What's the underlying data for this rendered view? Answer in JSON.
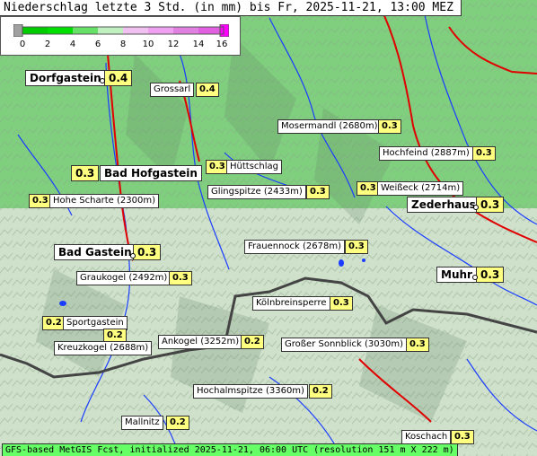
{
  "title": "Niederschlag letzte 3 Std. (in mm) bis Fr, 2025-11-21, 13:00 MEZ",
  "legend": {
    "ticks": [
      "0",
      "2",
      "4",
      "6",
      "8",
      "10",
      "12",
      "14",
      "16"
    ],
    "colors": [
      "#a0a0a0",
      "#00cc00",
      "#00e000",
      "#c0f0c0",
      "#f0c0f0",
      "#e080e0",
      "#ff00ff"
    ]
  },
  "places": [
    {
      "name": "Dorfgastein",
      "value": "0.4"
    },
    {
      "name": "Grossarl",
      "value": "0.4"
    },
    {
      "name": "Mosermandl (2680m)",
      "value": "0.3"
    },
    {
      "name": "Hochfeind (2887m)",
      "value": "0.3"
    },
    {
      "name": "Bad Hofgastein",
      "value": "0.3"
    },
    {
      "name": "Hüttschlag",
      "value": "0.3"
    },
    {
      "name": "Glingspitze (2433m)",
      "value": "0.3"
    },
    {
      "name": "Weißeck (2714m)",
      "value": "0.3"
    },
    {
      "name": "Zederhaus",
      "value": "0.3"
    },
    {
      "name": "Hohe Scharte (2300m)",
      "value": "0.3"
    },
    {
      "name": "Frauennock (2678m)",
      "value": "0.3"
    },
    {
      "name": "Bad Gastein",
      "value": "0.3"
    },
    {
      "name": "Graukogel (2492m)",
      "value": "0.3"
    },
    {
      "name": "Muhr",
      "value": "0.3"
    },
    {
      "name": "Kölnbreinsperre",
      "value": "0.3"
    },
    {
      "name": "Sportgastein",
      "value": "0.2"
    },
    {
      "name": "Kreuzkogel (2688m)",
      "value": "0.2"
    },
    {
      "name": "Ankogel (3252m)",
      "value": "0.2"
    },
    {
      "name": "Großer Sonnblick (3030m)",
      "value": "0.3"
    },
    {
      "name": "Hochalmspitze (3360m)",
      "value": "0.2"
    },
    {
      "name": "Mallnitz",
      "value": "0.2"
    },
    {
      "name": "Koschach",
      "value": "0.3"
    }
  ],
  "footer": "GFS-based MetGIS Fcst, initialized 2025-11-21, 06:00 UTC  (resolution 151 m X 222 m)"
}
